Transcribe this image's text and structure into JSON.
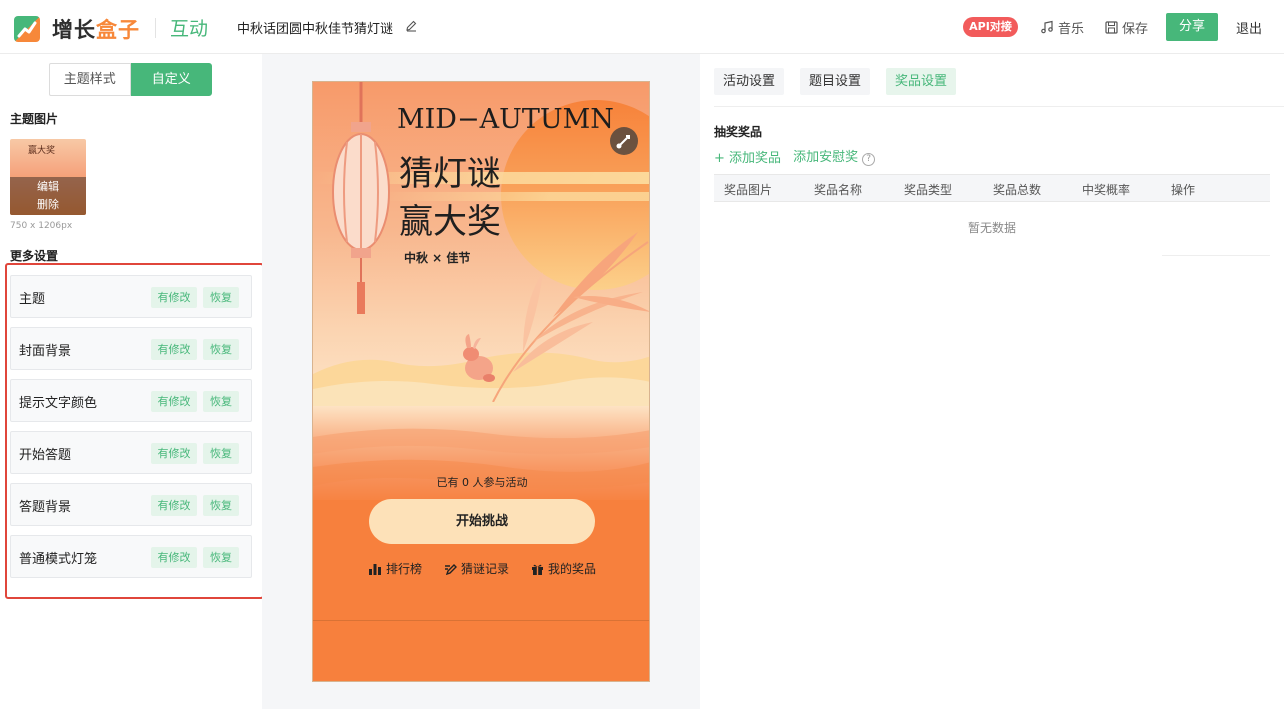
{
  "header": {
    "logo_part1": "增长",
    "logo_part2": "盒子",
    "module": "互动",
    "doc_title": "中秋话团圆中秋佳节猜灯谜",
    "api_badge": "API对接",
    "music_label": "音乐",
    "save_label": "保存",
    "share_label": "分享",
    "exit_label": "退出"
  },
  "left": {
    "seg_options": [
      "主题样式",
      "自定义"
    ],
    "theme_image_title": "主题图片",
    "thumb_text": "赢大奖",
    "edit_label": "编辑",
    "delete_label": "删除",
    "image_dim": "750 x 1206px",
    "more_settings_title": "更多设置",
    "settings": [
      {
        "label": "主题",
        "modified": "有修改",
        "restore": "恢复"
      },
      {
        "label": "封面背景",
        "modified": "有修改",
        "restore": "恢复"
      },
      {
        "label": "提示文字颜色",
        "modified": "有修改",
        "restore": "恢复"
      },
      {
        "label": "开始答题",
        "modified": "有修改",
        "restore": "恢复"
      },
      {
        "label": "答题背景",
        "modified": "有修改",
        "restore": "恢复"
      },
      {
        "label": "普通模式灯笼",
        "modified": "有修改",
        "restore": "恢复"
      }
    ],
    "collapse_icon": "‹"
  },
  "preview": {
    "en_title": "MID−AUTUMN",
    "cn_title1": "猜灯谜",
    "cn_title2": "赢大奖",
    "subtitle": "中秋 × 佳节",
    "participants": "已有 0 人参与活动",
    "start_button": "开始挑战",
    "links": [
      "排行榜",
      "猜谜记录",
      "我的奖品"
    ]
  },
  "right": {
    "tabs": [
      "活动设置",
      "题目设置",
      "奖品设置"
    ],
    "active_tab": "奖品设置",
    "prize_title": "抽奖奖品",
    "add_prize": "添加奖品",
    "add_consolation": "添加安慰奖",
    "columns": [
      "奖品图片",
      "奖品名称",
      "奖品类型",
      "奖品总数",
      "中奖概率",
      "操作"
    ],
    "empty_text": "暂无数据"
  },
  "colors": {
    "brand_green": "#47b77a",
    "brand_orange": "#f7883a",
    "highlight_red": "#e0463b",
    "api_red": "#f25b5b"
  }
}
